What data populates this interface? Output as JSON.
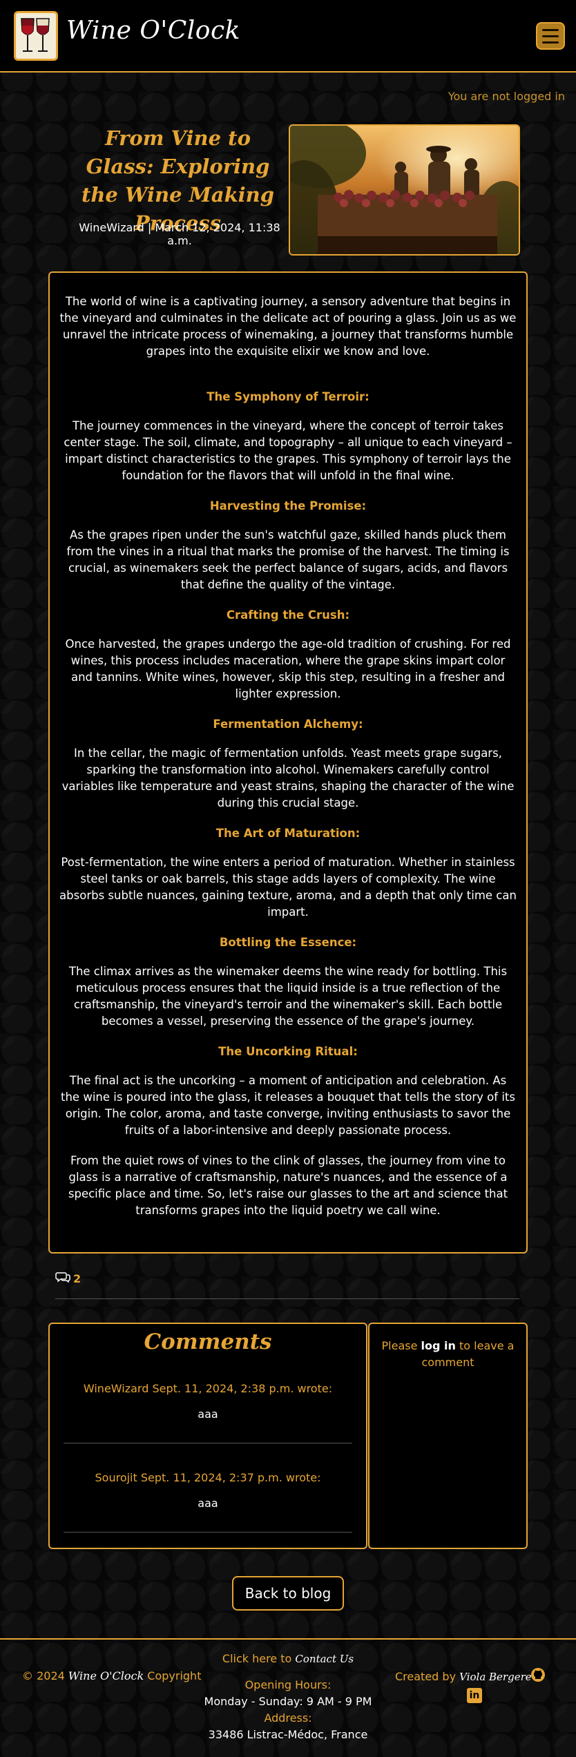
{
  "nav": {
    "brand": "Wine O'Clock",
    "logo_icon": "wine-glasses-icon",
    "menu_icon": "hamburger-menu-icon"
  },
  "login_status": "You are not logged in",
  "post": {
    "title": "From Vine to Glass: Exploring the Wine Making Process",
    "meta": "WineWizard | March 12, 2024, 11:38 a.m.",
    "image_subject": "winemakers harvesting grapes at sunset"
  },
  "article": {
    "intro": "The world of wine is a captivating journey, a sensory adventure that begins in the vineyard and culminates in the delicate act of pouring a glass. Join us as we unravel the intricate process of winemaking, a journey that transforms humble grapes into the exquisite elixir we know and love.",
    "sections": [
      {
        "heading": "The Symphony of Terroir:",
        "text": "The journey commences in the vineyard, where the concept of terroir takes center stage. The soil, climate, and topography – all unique to each vineyard – impart distinct characteristics to the grapes. This symphony of terroir lays the foundation for the flavors that will unfold in the final wine."
      },
      {
        "heading": "Harvesting the Promise:",
        "text": "As the grapes ripen under the sun's watchful gaze, skilled hands pluck them from the vines in a ritual that marks the promise of the harvest. The timing is crucial, as winemakers seek the perfect balance of sugars, acids, and flavors that define the quality of the vintage."
      },
      {
        "heading": "Crafting the Crush:",
        "text": "Once harvested, the grapes undergo the age-old tradition of crushing. For red wines, this process includes maceration, where the grape skins impart color and tannins. White wines, however, skip this step, resulting in a fresher and lighter expression."
      },
      {
        "heading": "Fermentation Alchemy:",
        "text": "In the cellar, the magic of fermentation unfolds. Yeast meets grape sugars, sparking the transformation into alcohol. Winemakers carefully control variables like temperature and yeast strains, shaping the character of the wine during this crucial stage."
      },
      {
        "heading": "The Art of Maturation:",
        "text": "Post-fermentation, the wine enters a period of maturation. Whether in stainless steel tanks or oak barrels, this stage adds layers of complexity. The wine absorbs subtle nuances, gaining texture, aroma, and a depth that only time can impart."
      },
      {
        "heading": "Bottling the Essence:",
        "text": "The climax arrives as the winemaker deems the wine ready for bottling. This meticulous process ensures that the liquid inside is a true reflection of the craftsmanship, the vineyard's terroir and the winemaker's skill. Each bottle becomes a vessel, preserving the essence of the grape's journey."
      },
      {
        "heading": "The Uncorking Ritual:",
        "text": "The final act is the uncorking – a moment of anticipation and celebration. As the wine is poured into the glass, it releases a bouquet that tells the story of its origin. The color, aroma, and taste converge, inviting enthusiasts to savor the fruits of a labor-intensive and deeply passionate process."
      }
    ],
    "outro": "From the quiet rows of vines to the clink of glasses, the journey from vine to glass is a narrative of craftsmanship, nature's nuances, and the essence of a specific place and time. So, let's raise our glasses to the art and science that transforms grapes into the liquid poetry we call wine."
  },
  "comment_count": "2",
  "comment_icon": "comments-icon",
  "comments": {
    "title": "Comments",
    "items": [
      {
        "header": "WineWizard Sept. 11, 2024, 2:38 p.m. wrote:",
        "body": "aaa"
      },
      {
        "header": "Sourojit Sept. 11, 2024, 2:37 p.m. wrote:",
        "body": "aaa"
      }
    ]
  },
  "login_prompt": {
    "before": "Please ",
    "link": "log in",
    "after": " to leave a comment"
  },
  "back_button": "Back to blog",
  "footer": {
    "copyright": "© 2024 ",
    "brand": "Wine O'Clock",
    "copyright_suffix": " Copyright",
    "contact_prefix": "Click here to ",
    "contact_link": "Contact Us",
    "hours_label": "Opening Hours:",
    "hours_value": "Monday - Sunday: 9 AM - 9 PM",
    "address_label": "Address:",
    "address_value": "33486 Listrac-Médoc, France",
    "created_by": "Created by ",
    "author": "Viola Bergere",
    "github_icon": "github-icon",
    "linkedin_icon": "linkedin-icon"
  },
  "colors": {
    "accent": "#e6a534",
    "background": "#070707"
  }
}
